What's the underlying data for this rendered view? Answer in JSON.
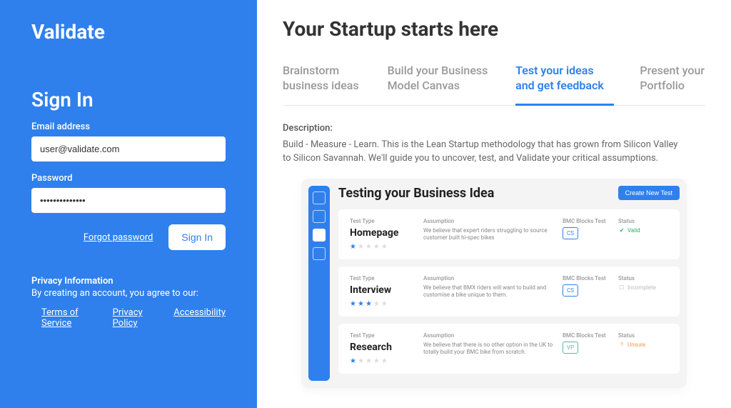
{
  "brand": "Validate",
  "signin": {
    "title": "Sign In",
    "email_label": "Email address",
    "email_value": "user@validate.com",
    "password_label": "Password",
    "password_value": "••••••••••••••",
    "forgot": "Forgot password",
    "button": "Sign In"
  },
  "privacy": {
    "heading": "Privacy Information",
    "sub": "By creating an account, you agree to our:",
    "links": [
      "Terms of Service",
      "Privacy Policy",
      "Accessibility"
    ]
  },
  "page_title": "Your Startup starts here",
  "tabs": [
    {
      "label": "Brainstorm business ideas",
      "active": false
    },
    {
      "label": "Build your Business Model Canvas",
      "active": false
    },
    {
      "label": "Test your ideas and get feedback",
      "active": true
    },
    {
      "label": "Present your Portfolio",
      "active": false
    }
  ],
  "description": {
    "label": "Description:",
    "text": "Build - Measure - Learn. This is the Lean Startup methodology that has grown from Silicon Valley to Silicon Savannah. We'll guide you to uncover, test, and Validate your critical assumptions."
  },
  "inner": {
    "title": "Testing your Business Idea",
    "new_test_btn": "Create New Test",
    "col_headers": {
      "type": "Test Type",
      "assumption": "Assumption",
      "blocks": "BMC Blocks Test",
      "status": "Status"
    },
    "tests": [
      {
        "name": "Homepage",
        "assumption": "We believe that expert riders struggling to source customer built hi-spec bikes",
        "block": "CS",
        "block_style": "cs",
        "status": "Valid",
        "status_class": "valid",
        "stars": 1
      },
      {
        "name": "Interview",
        "assumption": "We believe that BMX riders will want to build and customise a bike unique to them.",
        "block": "CS",
        "block_style": "cs",
        "status": "Incomplete",
        "status_class": "incomplete",
        "stars": 3
      },
      {
        "name": "Research",
        "assumption": "We believe that there is no other option in the UK to totally build your BMC bike from scratch.",
        "block": "VP",
        "block_style": "vp",
        "status": "Unsure",
        "status_class": "unsure",
        "stars": 1
      }
    ]
  }
}
